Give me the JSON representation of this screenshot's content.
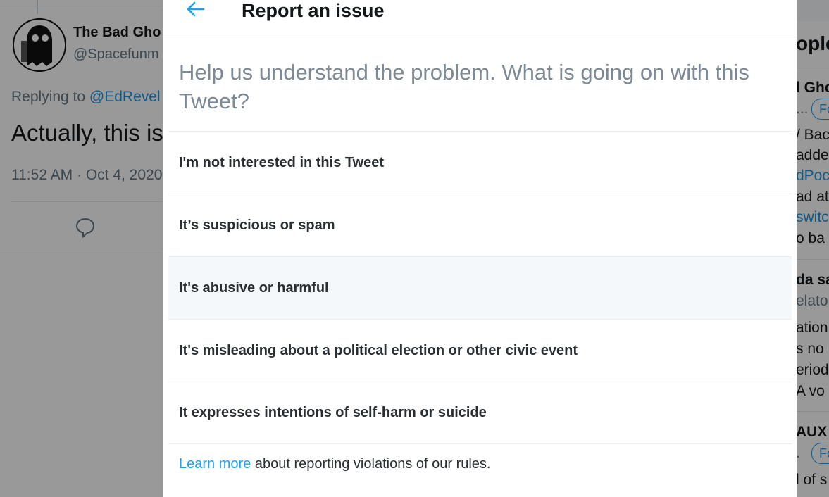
{
  "background": {
    "user_name": "The Bad Gho",
    "user_handle": "@Spacefunm",
    "replying_prefix": "Replying to ",
    "replying_link": "@EdRevel",
    "tweet_text": "Actually, this is",
    "tweet_time": "11:52 AM · Oct 4, 2020",
    "right_column": {
      "heading": "ople",
      "lines": [
        "l Gho",
        "...",
        "Fo",
        "/ Bac",
        "adde",
        "dPoc",
        "ad at",
        "switc",
        "o ba",
        "da sa",
        "elato",
        "ation",
        "s no",
        "eriod",
        "A vo",
        "AUX",
        ".",
        "Fo",
        "l of s"
      ]
    }
  },
  "modal": {
    "title": "Report an issue",
    "back_icon": "arrow-left-icon",
    "prompt": "Help us understand the problem. What is going on with this Tweet?",
    "options": [
      {
        "label": "I'm not interested in this Tweet"
      },
      {
        "label": "It’s suspicious or spam"
      },
      {
        "label": "It's abusive or harmful"
      },
      {
        "label": "It's misleading about a political election or other civic event"
      },
      {
        "label": "It expresses intentions of self-harm or suicide"
      }
    ],
    "footer_link": "Learn more",
    "footer_text": " about reporting violations of our rules."
  },
  "colors": {
    "accent": "#1da1f2",
    "overlay": "rgba(0,0,0,0.4)",
    "hover_row": "#f5f8fa"
  }
}
